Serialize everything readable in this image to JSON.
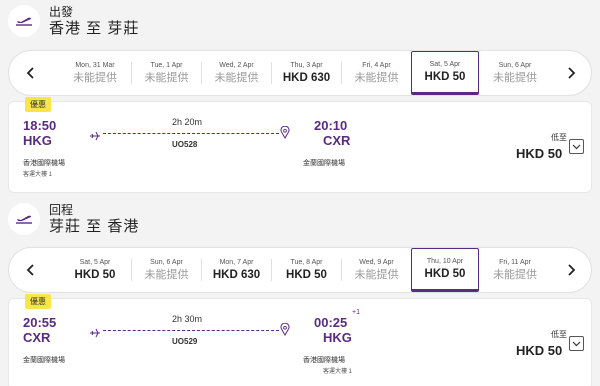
{
  "outbound": {
    "label": "出發",
    "route": "香港 至 芽莊",
    "dates": [
      {
        "day": "Mon, 31 Mar",
        "price": "未能提供",
        "available": false,
        "selected": false
      },
      {
        "day": "Tue, 1 Apr",
        "price": "未能提供",
        "available": false,
        "selected": false
      },
      {
        "day": "Wed, 2 Apr",
        "price": "未能提供",
        "available": false,
        "selected": false
      },
      {
        "day": "Thu, 3 Apr",
        "price": "HKD 630",
        "available": true,
        "selected": false
      },
      {
        "day": "Fri, 4 Apr",
        "price": "未能提供",
        "available": false,
        "selected": false
      },
      {
        "day": "Sat, 5 Apr",
        "price": "HKD 50",
        "available": true,
        "selected": true
      },
      {
        "day": "Sun, 6 Apr",
        "price": "未能提供",
        "available": false,
        "selected": false
      }
    ],
    "flight": {
      "badge": "優惠",
      "dep_time": "18:50",
      "dep_code": "HKG",
      "dep_airport": "香港國際機場",
      "dep_terminal": "客運大樓 1",
      "duration": "2h 20m",
      "flight_no": "UO528",
      "arr_time": "20:10",
      "arr_code": "CXR",
      "arr_airport": "金蘭國際機場",
      "arr_terminal": "",
      "day_offset": "",
      "from_label": "低至",
      "price": "HKD 50"
    }
  },
  "inbound": {
    "label": "回程",
    "route": "芽莊 至 香港",
    "dates": [
      {
        "day": "Sat, 5 Apr",
        "price": "HKD 50",
        "available": true,
        "selected": false
      },
      {
        "day": "Sun, 6 Apr",
        "price": "未能提供",
        "available": false,
        "selected": false
      },
      {
        "day": "Mon, 7 Apr",
        "price": "HKD 630",
        "available": true,
        "selected": false
      },
      {
        "day": "Tue, 8 Apr",
        "price": "HKD 50",
        "available": true,
        "selected": false
      },
      {
        "day": "Wed, 9 Apr",
        "price": "未能提供",
        "available": false,
        "selected": false
      },
      {
        "day": "Thu, 10 Apr",
        "price": "HKD 50",
        "available": true,
        "selected": true
      },
      {
        "day": "Fri, 11 Apr",
        "price": "未能提供",
        "available": false,
        "selected": false
      }
    ],
    "flight": {
      "badge": "優惠",
      "dep_time": "20:55",
      "dep_code": "CXR",
      "dep_airport": "金蘭國際機場",
      "dep_terminal": "",
      "duration": "2h 30m",
      "flight_no": "UO529",
      "arr_time": "00:25",
      "arr_code": "HKG",
      "arr_airport": "香港國際機場",
      "arr_terminal": "客運大樓 1",
      "day_offset": "+1",
      "from_label": "低至",
      "price": "HKD 50"
    }
  },
  "colors": {
    "accent": "#5a2a82",
    "badge": "#f9e547",
    "background": "#f3f3f3"
  },
  "icons": {
    "section": "plane-takeoff-icon",
    "prev": "chevron-left-icon",
    "next": "chevron-right-icon",
    "depart": "plane-icon",
    "arrive": "location-pin-icon",
    "expand": "chevron-down-icon"
  }
}
